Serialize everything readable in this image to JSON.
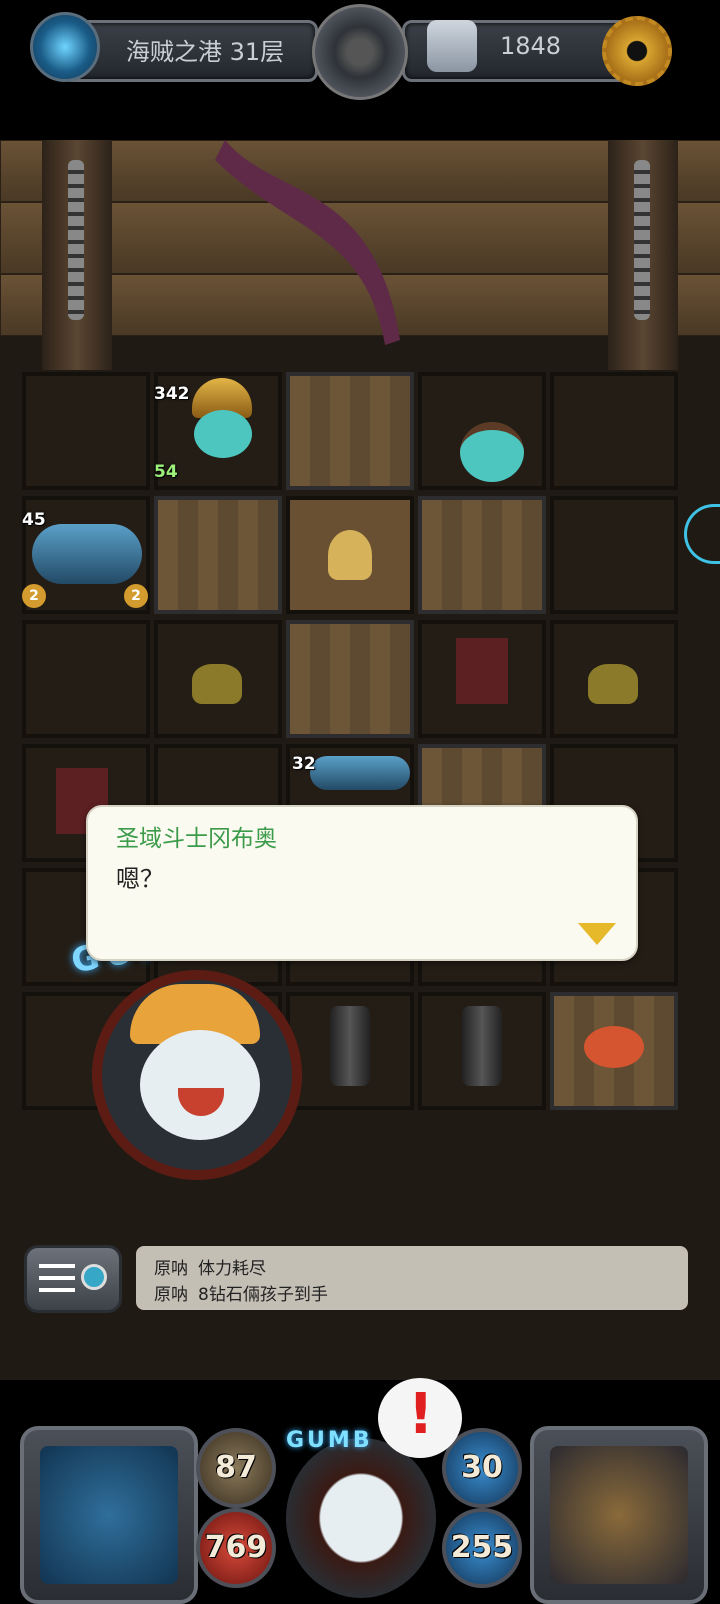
{
  "top_bar": {
    "floor_label": "海贼之港 31层",
    "score": "1848",
    "icons": [
      "portal-icon",
      "medallion-icon",
      "shield-icon",
      "gear-icon"
    ]
  },
  "board": {
    "numbers": {
      "warrior_hp": "342",
      "warrior_level": "54",
      "cannon_hp": "45",
      "cannon_left_badge": "2",
      "cannon_right_badge": "2",
      "cannon2_hp": "32"
    }
  },
  "dialog": {
    "speaker": "圣域斗士冈布奥",
    "text": "嗯？"
  },
  "gumball_text": "GUMBALL",
  "chat": {
    "messages": [
      {
        "name": "原呐",
        "text": "体力耗尽"
      },
      {
        "name": "原呐",
        "text": "8钻石倆孩子到手"
      }
    ]
  },
  "hud": {
    "attack": "87",
    "hp": "769",
    "defense": "30",
    "mp": "255",
    "gumball_logo": "GUMB",
    "alert": "!"
  }
}
